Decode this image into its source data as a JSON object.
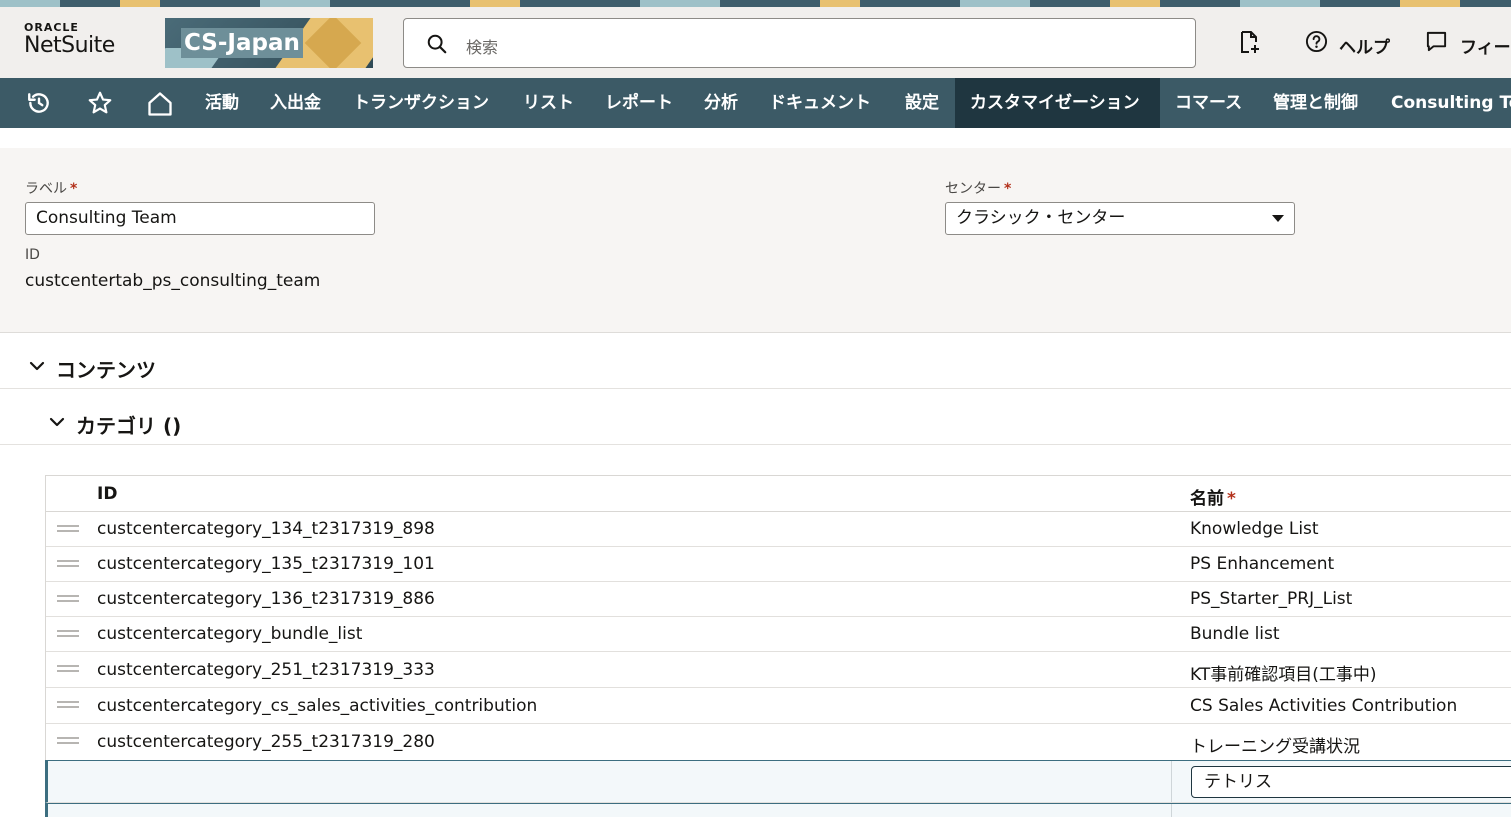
{
  "header": {
    "logo_top": "ORACLE",
    "logo_bottom": "NetSuite",
    "brand_text": "CS-Japan",
    "search_placeholder": "検索",
    "help_label": "ヘルプ",
    "feedback_label": "フィー"
  },
  "nav": {
    "items": [
      {
        "label": "活動"
      },
      {
        "label": "入出金"
      },
      {
        "label": "トランザクション"
      },
      {
        "label": "リスト"
      },
      {
        "label": "レポート"
      },
      {
        "label": "分析"
      },
      {
        "label": "ドキュメント"
      },
      {
        "label": "設定"
      },
      {
        "label": "カスタマイゼーション",
        "active": true
      },
      {
        "label": "コマース"
      },
      {
        "label": "管理と制御"
      },
      {
        "label": "Consulting Tea"
      }
    ]
  },
  "form": {
    "label_caption": "ラベル",
    "label_value": "Consulting Team",
    "id_caption": "ID",
    "id_value": "custcentertab_ps_consulting_team",
    "center_caption": "センター",
    "center_value": "クラシック・センター",
    "required_mark": "*"
  },
  "sections": {
    "contents_title": "コンテンツ",
    "category_title": "カテゴリ ()"
  },
  "table": {
    "columns": {
      "id": "ID",
      "name": "名前"
    },
    "rows": [
      {
        "id": "custcentercategory_134_t2317319_898",
        "name": "Knowledge List"
      },
      {
        "id": "custcentercategory_135_t2317319_101",
        "name": "PS Enhancement"
      },
      {
        "id": "custcentercategory_136_t2317319_886",
        "name": "PS_Starter_PRJ_List"
      },
      {
        "id": "custcentercategory_bundle_list",
        "name": "Bundle list"
      },
      {
        "id": "custcentercategory_251_t2317319_333",
        "name": "KT事前確認項目(工事中)"
      },
      {
        "id": "custcentercategory_cs_sales_activities_contribution",
        "name": "CS Sales Activities Contribution"
      },
      {
        "id": "custcentercategory_255_t2317319_280",
        "name": "トレーニング受講状況"
      }
    ],
    "edit_value": "テトリス"
  },
  "colors": {
    "nav_bg": "#3c5a66",
    "nav_active": "#1f3640",
    "header_bg": "#f1efed",
    "required": "#b3311b"
  }
}
